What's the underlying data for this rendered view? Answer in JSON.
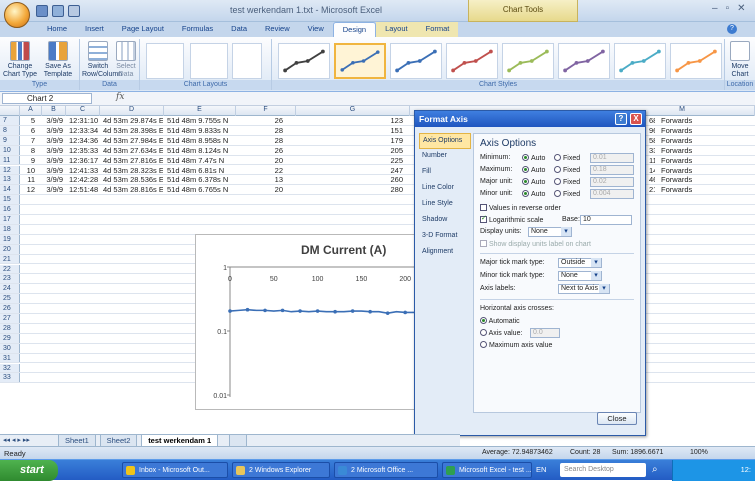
{
  "app": {
    "window_title": "test werkendam 1.txt - Microsoft Excel",
    "chart_tools_label": "Chart Tools"
  },
  "tabs": [
    "Home",
    "Insert",
    "Page Layout",
    "Formulas",
    "Data",
    "Review",
    "View",
    "Design",
    "Layout",
    "Format"
  ],
  "active_tab": "Design",
  "ribbon": {
    "change_chart_type": "Change Chart Type",
    "save_as_template": "Save As Template",
    "switch_row_column": "Switch Row/Column",
    "select_data": "Select Data",
    "group_type": "Type",
    "group_data": "Data",
    "group_layouts": "Chart Layouts",
    "group_styles": "Chart Styles",
    "move_chart": "Move Chart",
    "group_location": "Location",
    "style_colors": [
      "#404040",
      "#3b6fb6",
      "#3b6fb6",
      "#c0504d",
      "#9bbb59",
      "#8064a2",
      "#4bacc6",
      "#f79646"
    ]
  },
  "formula_bar": {
    "name_box": "Chart 2",
    "fx": "fx"
  },
  "columns": [
    "A",
    "B",
    "C",
    "D",
    "E",
    "F",
    "G",
    "M"
  ],
  "rows": [
    {
      "num": "7",
      "a": "5",
      "b": "3/9/9",
      "c": "12:31:10",
      "d": "4d 53m 29.874s E",
      "e": "51d 48m 9.755s N",
      "f": "26",
      "g": "123",
      "l": "68",
      "m": "Forwards"
    },
    {
      "num": "8",
      "a": "6",
      "b": "3/9/9",
      "c": "12:33:34",
      "d": "4d 53m 28.398s E",
      "e": "51d 48m 9.833s N",
      "f": "28",
      "g": "151",
      "l": "96",
      "m": "Forwards"
    },
    {
      "num": "9",
      "a": "7",
      "b": "3/9/9",
      "c": "12:34:36",
      "d": "4d 53m 27.984s E",
      "e": "51d 48m 8.958s N",
      "f": "28",
      "g": "179",
      "l": "58",
      "m": "Forwards"
    },
    {
      "num": "10",
      "a": "8",
      "b": "3/9/9",
      "c": "12:35:33",
      "d": "4d 53m 27.634s E",
      "e": "51d 48m 8.124s N",
      "f": "26",
      "g": "205",
      "l": "33",
      "m": "Forwards"
    },
    {
      "num": "11",
      "a": "9",
      "b": "3/9/9",
      "c": "12:36:17",
      "d": "4d 53m 27.816s E",
      "e": "51d 48m 7.47s N",
      "f": "20",
      "g": "225",
      "l": "11",
      "m": "Forwards"
    },
    {
      "num": "12",
      "a": "10",
      "b": "3/9/9",
      "c": "12:41:33",
      "d": "4d 53m 28.323s E",
      "e": "51d 48m 6.81s N",
      "f": "22",
      "g": "247",
      "l": "14",
      "m": "Forwards"
    },
    {
      "num": "13",
      "a": "11",
      "b": "3/9/9",
      "c": "12:42:28",
      "d": "4d 53m 28.536s E",
      "e": "51d 48m 6.378s N",
      "f": "13",
      "g": "260",
      "l": "46",
      "m": "Forwards"
    },
    {
      "num": "14",
      "a": "12",
      "b": "3/9/9",
      "c": "12:51:48",
      "d": "4d 53m 28.816s E",
      "e": "51d 48m 6.765s N",
      "f": "20",
      "g": "280",
      "l": "21",
      "m": "Forwards"
    }
  ],
  "empty_rows": [
    "15",
    "16",
    "17",
    "18",
    "19",
    "20",
    "21",
    "22",
    "23",
    "24",
    "25",
    "26",
    "27",
    "28",
    "29",
    "30",
    "31",
    "32",
    "33"
  ],
  "chart": {
    "title": "DM Current (A)",
    "x_ticks": [
      "0",
      "50",
      "100",
      "150",
      "200",
      "25"
    ],
    "y_ticks": [
      "1",
      "0.1",
      "0.01"
    ],
    "line_color": "#3b6fb6"
  },
  "chart_data": {
    "type": "line",
    "title": "DM Current (A)",
    "xlabel": "",
    "ylabel": "",
    "y_scale": "log",
    "ylim": [
      0.01,
      1
    ],
    "x": [
      0,
      10,
      20,
      30,
      40,
      50,
      60,
      70,
      80,
      90,
      100,
      110,
      120,
      130,
      140,
      150,
      160,
      170,
      180,
      190,
      200,
      210,
      220
    ],
    "series": [
      {
        "values": [
          0.205,
          0.21,
          0.215,
          0.21,
          0.21,
          0.205,
          0.21,
          0.2,
          0.205,
          0.2,
          0.205,
          0.2,
          0.2,
          0.2,
          0.205,
          0.205,
          0.2,
          0.2,
          0.19,
          0.2,
          0.195,
          0.195,
          0.19
        ]
      }
    ]
  },
  "sheet_tabs": [
    "Sheet1",
    "Sheet2",
    "test werkendam 1"
  ],
  "active_sheet": "test werkendam 1",
  "status": {
    "ready": "Ready",
    "average": "Average: 72.94873462",
    "count": "Count: 28",
    "sum": "Sum: 1896.6671",
    "zoom": "100%"
  },
  "taskbar": {
    "start": "start",
    "items": [
      "Inbox - Microsoft Out...",
      "2 Windows Explorer",
      "2 Microsoft Office ...",
      "Microsoft Excel - test ..."
    ],
    "lang": "EN",
    "search_placeholder": "Search Desktop",
    "clock": "12:"
  },
  "format_axis": {
    "title": "Format Axis",
    "help": "?",
    "close_x": "X",
    "nav": [
      "Axis Options",
      "Number",
      "Fill",
      "Line Color",
      "Line Style",
      "Shadow",
      "3-D Format",
      "Alignment"
    ],
    "active_nav": "Axis Options",
    "heading": "Axis Options",
    "minimum": "Minimum:",
    "maximum": "Maximum:",
    "major_unit": "Major unit:",
    "minor_unit": "Minor unit:",
    "auto": "Auto",
    "fixed": "Fixed",
    "min_value": "0.01",
    "max_value": "0.18",
    "major_value": "0.02",
    "minor_value": "0.004",
    "values_reverse": "Values in reverse order",
    "log_scale": "Logarithmic scale",
    "base_label": "Base:",
    "base_value": "10",
    "display_units_label": "Display units:",
    "display_units_value": "None",
    "show_units_label": "Show display units label on chart",
    "major_tick_label": "Major tick mark type:",
    "major_tick_value": "Outside",
    "minor_tick_label": "Minor tick mark type:",
    "minor_tick_value": "None",
    "axis_labels_label": "Axis labels:",
    "axis_labels_value": "Next to Axis",
    "horiz_crosses": "Horizontal axis crosses:",
    "automatic": "Automatic",
    "axis_value": "Axis value:",
    "axis_value_input": "0.0",
    "max_axis_value": "Maximum axis value",
    "close_button": "Close"
  }
}
